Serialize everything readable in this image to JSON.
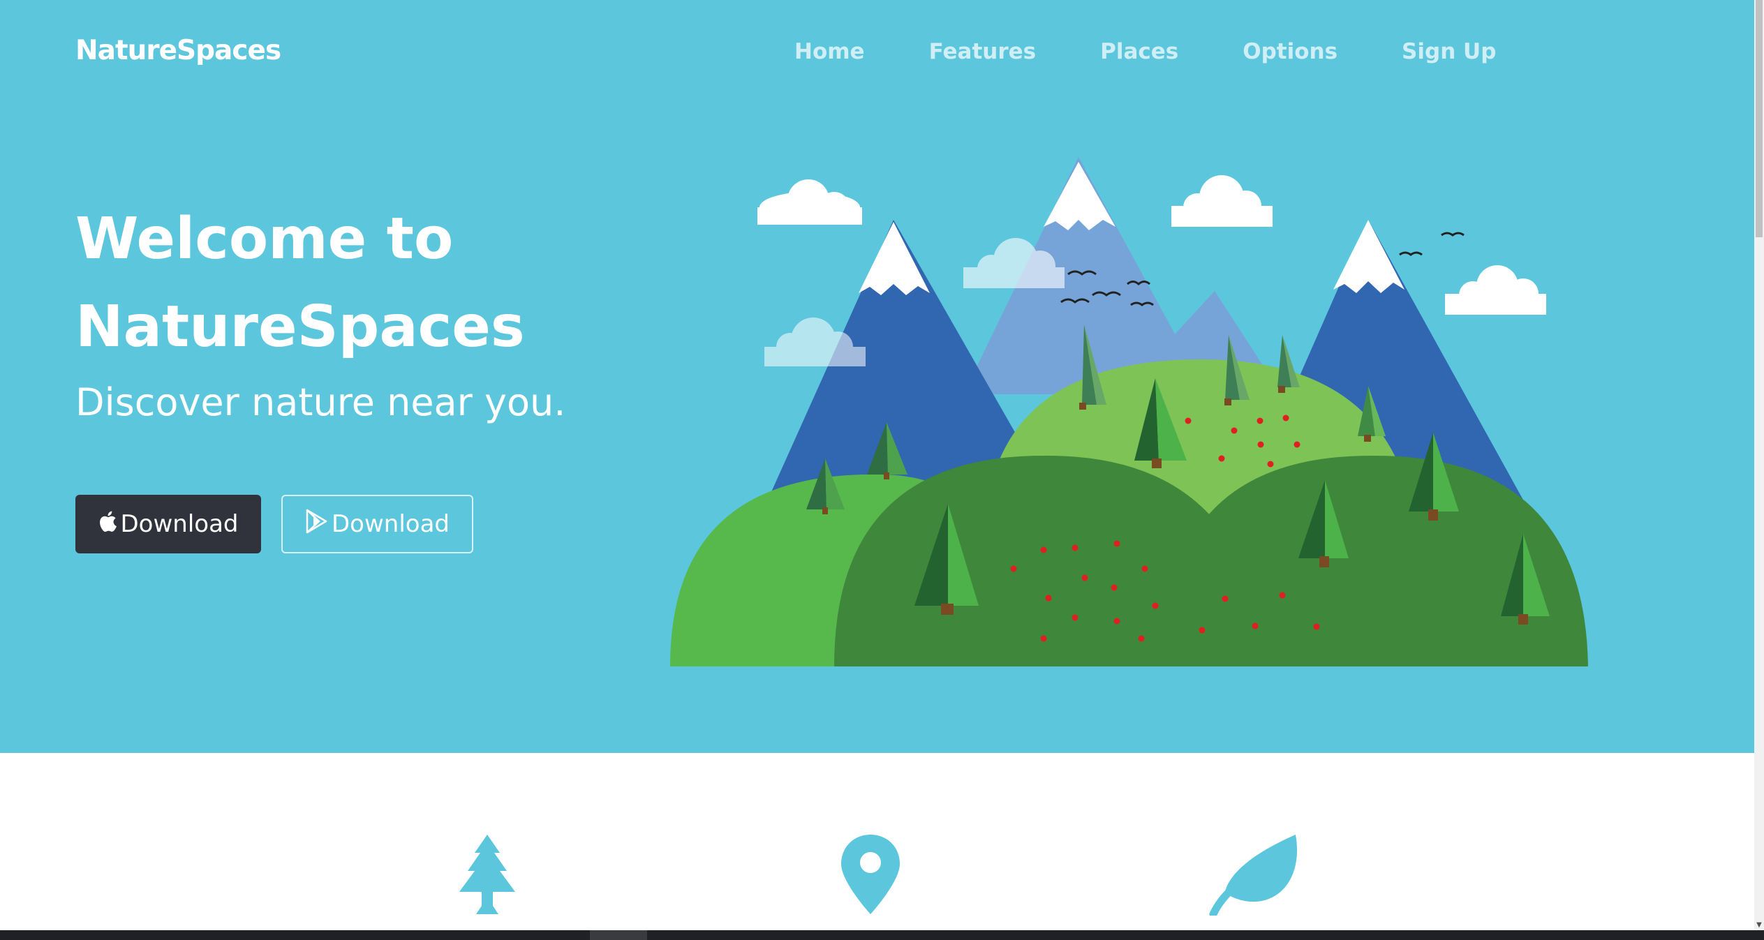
{
  "brand": "NatureSpaces",
  "nav": {
    "items": [
      "Home",
      "Features",
      "Places",
      "Options",
      "Sign Up"
    ]
  },
  "hero": {
    "headline_line1": "Welcome to",
    "headline_line2": "NatureSpaces",
    "subtitle": "Discover nature near you.",
    "apple_button": "Download",
    "play_button": "Download"
  },
  "features": {
    "icons": [
      "tree-icon",
      "map-pin-icon",
      "leaf-icon"
    ]
  },
  "colors": {
    "hero_bg": "#5bc6dc",
    "dark_button": "#31333c",
    "feature_icon": "#5bc6dc"
  }
}
